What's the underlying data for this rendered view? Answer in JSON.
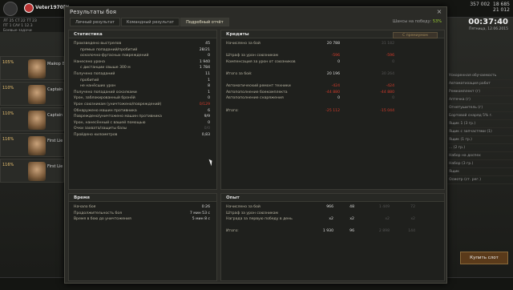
{
  "topbar": {
    "username": "Veter1970[Y",
    "gold": "357 002",
    "credits": "18 685",
    "xp": "21 012",
    "clock": "00:37:40",
    "date": "Пятница, 12.06.2015",
    "stat_lines": [
      "ЛТ 25  СТ 22  ТТ 23",
      "ПТ 1  САУ 1  12.3"
    ],
    "weather_note": "Боевые задачи"
  },
  "crew": [
    {
      "pct": "105%",
      "rank": "Майор В"
    },
    {
      "pct": "110%",
      "rank": "Captain"
    },
    {
      "pct": "110%",
      "rank": "Captain"
    },
    {
      "pct": "116%",
      "rank": "First Lie"
    },
    {
      "pct": "116%",
      "rank": "First Lie"
    }
  ],
  "right_list": [
    "Ускоренная обучаемость",
    "Автоматизация работ",
    "Ремкомплект (г)",
    "Аптечка (г)",
    "Огнетушитель (г)",
    "Бортовой снаряд 5% г.",
    "Ящик 1 (3 гр.)",
    "Ящик с запчастями (1)",
    "Ящик (1 гр.)",
    "... (2 гр.)",
    "Набор на доспех",
    "Набор (3 гр.)",
    "Ящик",
    "Осмотр (ст. рег.)"
  ],
  "buy_button": "Купить слот",
  "dialog": {
    "title": "Результаты боя",
    "close": "×",
    "tabs": [
      "Личный результат",
      "Командный результат",
      "Подробный отчёт"
    ],
    "win_chance_label": "Шансы на победу:",
    "win_chance_value": "53%",
    "stats": {
      "header": "Статистика",
      "rows": [
        {
          "label": "Произведено выстрелов",
          "value": "45",
          "indent": false
        },
        {
          "label": "прямых попаданий/пробитий",
          "value": "28/21",
          "indent": true
        },
        {
          "label": "осколочно-фугасных повреждений",
          "value": "0",
          "indent": true
        },
        {
          "label": "Нанесено урона",
          "value": "1 940",
          "indent": false
        },
        {
          "label": "с дистанции свыше 300 м",
          "value": "1 784",
          "indent": true
        },
        {
          "label": "Получено попаданий",
          "value": "11",
          "indent": false
        },
        {
          "label": "пробитий",
          "value": "1",
          "indent": true
        },
        {
          "label": "не нанёсших урон",
          "value": "8",
          "indent": true
        },
        {
          "label": "Получено попаданий осколками",
          "value": "1",
          "indent": false
        },
        {
          "label": "Урон, заблокированный бронёй",
          "value": "0",
          "indent": false
        },
        {
          "label": "Урон союзникам (уничтожено/повреждений)",
          "value": "0/129",
          "indent": false,
          "red": true
        },
        {
          "label": "Обнаружено машин противника",
          "value": "6",
          "indent": false
        },
        {
          "label": "Повреждено/уничтожено машин противника",
          "value": "9/9",
          "indent": false
        },
        {
          "label": "Урон, нанесённый с вашей помощью",
          "value": "0",
          "indent": false
        },
        {
          "label": "Очки захвата/защиты базы",
          "value": "0/0",
          "indent": false,
          "dim": true
        },
        {
          "label": "Пройдено километров",
          "value": "0,83",
          "indent": false
        }
      ]
    },
    "time": {
      "header": "Время",
      "rows": [
        {
          "label": "Начало боя",
          "value": "0:26"
        },
        {
          "label": "Продолжительность боя",
          "value": "7 мин 53 с"
        },
        {
          "label": "Время в бою до уничтожения",
          "value": "5 мин 8 с"
        }
      ]
    },
    "credits": {
      "header": "Кредиты",
      "premium_button": "С премиумом",
      "rows": [
        {
          "label": "Начислено за бой",
          "c1": "20 788",
          "c2": "31 182"
        },
        {
          "label": "",
          "c1": "",
          "c2": ""
        },
        {
          "label": "Штраф за урон союзникам",
          "c1": "-596",
          "c2": "-596",
          "red": true
        },
        {
          "label": "Компенсация за урон от союзников",
          "c1": "0",
          "c2": "0"
        },
        {
          "label": "",
          "c1": "",
          "c2": ""
        },
        {
          "label": "Итого за бой:",
          "c1": "20 196",
          "c2": "30 264"
        },
        {
          "label": "",
          "c1": "",
          "c2": ""
        },
        {
          "label": "Автоматический ремонт техники",
          "c1": "-424",
          "c2": "-424",
          "red": true
        },
        {
          "label": "Автопополнение боекомплекта",
          "c1": "-44 880",
          "c2": "-44 880",
          "red": true
        },
        {
          "label": "Автопополнение снаряжения",
          "c1": "0",
          "c2": "0"
        },
        {
          "label": "",
          "c1": "",
          "c2": ""
        },
        {
          "label": "Итого:",
          "c1": "-25 112",
          "c2": "-15 044",
          "red": true
        }
      ]
    },
    "xp": {
      "header": "Опыт",
      "rows": [
        {
          "label": "Начислено за бой",
          "x1": "966",
          "x2": "48",
          "x3": "1 449",
          "x4": "72"
        },
        {
          "label": "Штраф за урон союзникам",
          "x1": "",
          "x2": "",
          "x3": "",
          "x4": ""
        },
        {
          "label": "Награда за первую победу в день",
          "x1": "x2",
          "x2": "x2",
          "x3": "x2",
          "x4": "x2"
        },
        {
          "label": "",
          "x1": "",
          "x2": "",
          "x3": "",
          "x4": ""
        },
        {
          "label": "Итого:",
          "x1": "1 930",
          "x2": "96",
          "x3": "2 898",
          "x4": "144"
        }
      ]
    }
  }
}
